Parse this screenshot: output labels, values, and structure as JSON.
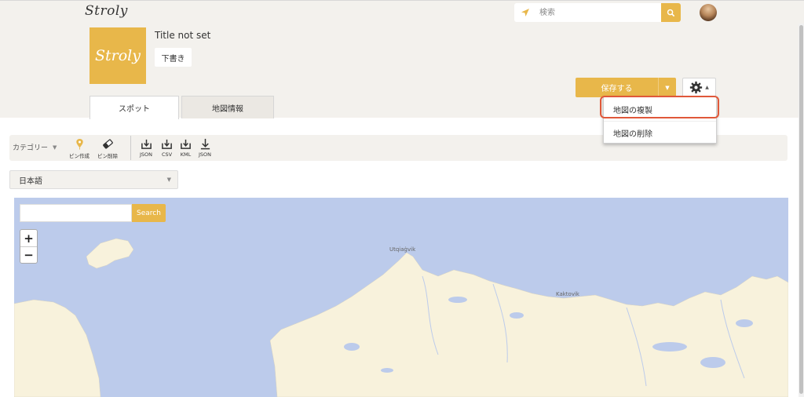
{
  "header": {
    "logo_text": "Stroly",
    "search": {
      "placeholder": "検索"
    }
  },
  "map_info": {
    "thumbnail_text": "Stroly",
    "title": "Title not set",
    "draft_label": "下書き"
  },
  "actions": {
    "save_label": "保存する",
    "settings_menu": [
      "地図の複製",
      "地図の削除"
    ]
  },
  "tabs": [
    {
      "label": "スポット",
      "active": true
    },
    {
      "label": "地図情報",
      "active": false
    }
  ],
  "toolbar": {
    "category_label": "カテゴリー",
    "tools": [
      {
        "label": "ピン作成",
        "icon": "pin-icon"
      },
      {
        "label": "ピン削除",
        "icon": "eraser-icon"
      },
      {
        "label": "JSON",
        "icon": "import-icon"
      },
      {
        "label": "CSV",
        "icon": "import-icon"
      },
      {
        "label": "KML",
        "icon": "import-icon"
      },
      {
        "label": "JSON",
        "icon": "download-icon"
      }
    ]
  },
  "language_select": {
    "value": "日本語"
  },
  "map_view": {
    "search_button": "Search",
    "zoom_in": "+",
    "zoom_out": "−",
    "places": [
      "Utqiaġvik",
      "Kaktovik"
    ]
  },
  "colors": {
    "accent": "#e8b74a",
    "header_bg": "#f3f1ed",
    "water": "#bccbeb",
    "land": "#f8f2dc",
    "highlight": "#e0583a"
  }
}
